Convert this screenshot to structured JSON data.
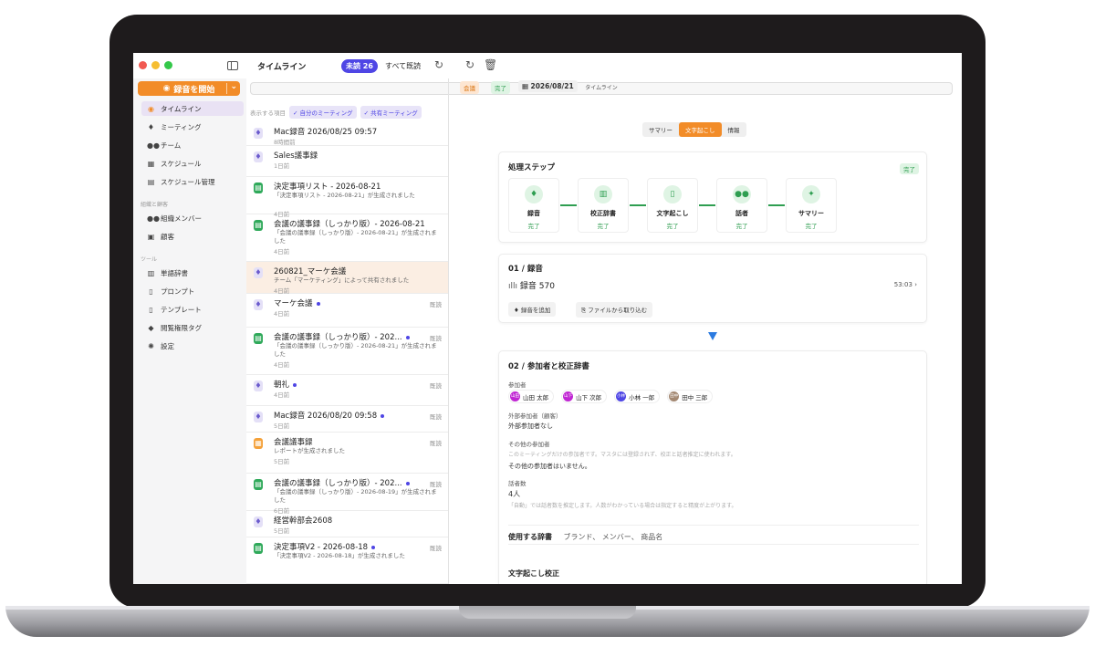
{
  "titlebar": {
    "title": "タイムライン",
    "unread": "未読 26",
    "read_all": "すべて既読"
  },
  "search": {
    "placeholder": "タイムライン"
  },
  "sidebar": {
    "record_button": "録音を開始",
    "items": [
      {
        "label": "タイムライン",
        "icon": "timeline-icon"
      },
      {
        "label": "ミーティング",
        "icon": "mic-icon"
      },
      {
        "label": "チーム",
        "icon": "team-icon"
      },
      {
        "label": "スケジュール",
        "icon": "calendar-icon"
      },
      {
        "label": "スケジュール管理",
        "icon": "calendar-manage-icon"
      }
    ],
    "section_org": "組織と顧客",
    "org_items": [
      {
        "label": "組織メンバー"
      },
      {
        "label": "顧客"
      }
    ],
    "section_tools": "ツール",
    "tool_items": [
      {
        "label": "単語辞書"
      },
      {
        "label": "プロンプト"
      },
      {
        "label": "テンプレート"
      },
      {
        "label": "閲覧権限タグ"
      },
      {
        "label": "設定"
      }
    ]
  },
  "filters": {
    "label": "表示する項目",
    "mine": "✓ 自分のミーティング",
    "shared": "✓ 共有ミーティング"
  },
  "items": [
    {
      "title": "Mac録音 2026/08/25 09:57",
      "sub": "",
      "ago": "8時間前",
      "type": "mic",
      "read": ""
    },
    {
      "title": "Sales議事録",
      "sub": "",
      "ago": "1日前",
      "type": "mic",
      "read": ""
    },
    {
      "title": "決定事項リスト - 2026-08-21",
      "sub": "「決定事項リスト - 2026-08-21」が生成されました",
      "ago": "4日前",
      "type": "doc",
      "read": ""
    },
    {
      "title": "会議の議事録（しっかり版）- 2026-08-21",
      "sub": "「会議の議事録（しっかり版）- 2026-08-21」が生成されました",
      "ago": "4日前",
      "type": "doc",
      "read": ""
    },
    {
      "title": "260821_マーケ会議",
      "sub": "チーム「マーケティング」によって共有されました",
      "ago": "4日前",
      "type": "mic",
      "read": ""
    },
    {
      "title": "マーケ会議",
      "sub": "",
      "ago": "4日前",
      "type": "mic",
      "read": "既読"
    },
    {
      "title": "会議の議事録（しっかり版）- 202...",
      "sub": "「会議の議事録（しっかり版）- 2026-08-21」が生成されました",
      "ago": "4日前",
      "type": "doc",
      "read": "既読"
    },
    {
      "title": "朝礼",
      "sub": "",
      "ago": "4日前",
      "type": "mic",
      "read": "既読"
    },
    {
      "title": "Mac録音 2026/08/20 09:58",
      "sub": "",
      "ago": "5日前",
      "type": "mic",
      "read": "既読"
    },
    {
      "title": "会議議事録",
      "sub": "レポートが生成されました",
      "ago": "5日前",
      "type": "cal",
      "read": "既読"
    },
    {
      "title": "会議の議事録（しっかり版）- 202...",
      "sub": "「会議の議事録（しっかり版）- 2026-08-19」が生成されました",
      "ago": "6日前",
      "type": "doc",
      "read": "既読"
    },
    {
      "title": "経営幹部会2608",
      "sub": "",
      "ago": "5日前",
      "type": "mic",
      "read": ""
    },
    {
      "title": "決定事項V2 - 2026-08-18",
      "sub": "「決定事項V2 - 2026-08-18」が生成されました",
      "ago": "",
      "type": "doc",
      "read": "既読"
    }
  ],
  "detail": {
    "tags": {
      "meeting": "会議",
      "done": "完了",
      "date": "2026/08/21"
    },
    "tabs": [
      "サマリー",
      "文字起こし",
      "情報"
    ],
    "steps_card": {
      "title": "処理ステップ",
      "status": "完了",
      "steps": [
        {
          "label": "録音",
          "status": "完了"
        },
        {
          "label": "校正辞書",
          "status": "完了"
        },
        {
          "label": "文字起こし",
          "status": "完了"
        },
        {
          "label": "話者",
          "status": "完了"
        },
        {
          "label": "サマリー",
          "status": "完了"
        }
      ]
    },
    "rec_card": {
      "title": "01 / 録音",
      "name": "録音 570",
      "duration": "53:03",
      "add": "録音を追加",
      "import": "ファイルから取り込む"
    },
    "part_card": {
      "title": "02 / 参加者と校正辞書",
      "attendees_label": "参加者",
      "attendees": [
        {
          "name": "山田 太郎",
          "abbr": "山田",
          "color": "#c026d3"
        },
        {
          "name": "山下 次郎",
          "abbr": "山下",
          "color": "#c026d3"
        },
        {
          "name": "小林 一郎",
          "abbr": "小林",
          "color": "#4f46e5"
        },
        {
          "name": "田中 三郎",
          "abbr": "田中",
          "color": "#a38872"
        }
      ],
      "external_label": "外部参加者（顧客）",
      "external_val": "外部参加者なし",
      "other_label": "その他の参加者",
      "other_hint": "このミーティングだけの参加者です。マスタには登録されず、校正と話者推定に使われます。",
      "other_val": "その他の参加者はいません。",
      "speakers_label": "話者数",
      "speakers_val": "4人",
      "speakers_hint": "「自動」では話者数を推定します。人数がわかっている場合は指定すると精度が上がります。",
      "dict_label": "使用する辞書",
      "dict_placeholder": "ブランド、 メンバー、 商品名",
      "correction_label": "文字起こし校正"
    }
  }
}
